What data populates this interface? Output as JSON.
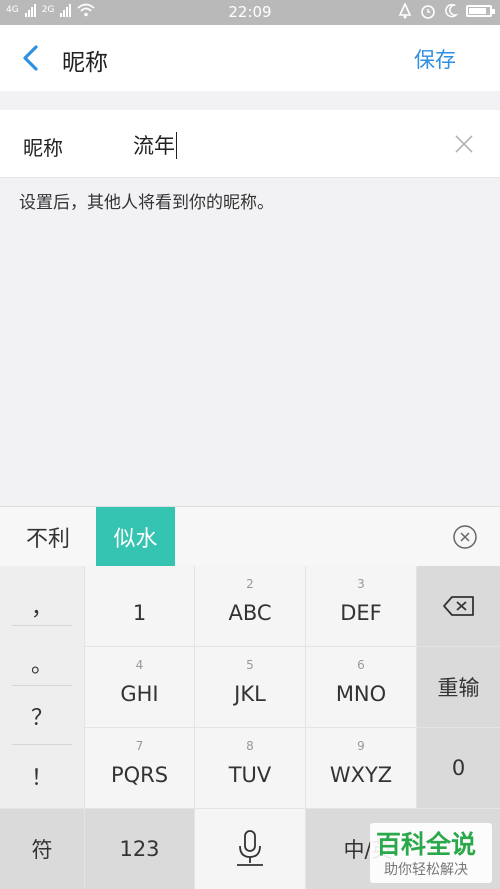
{
  "status_bar": {
    "net1": "4G",
    "net2": "2G",
    "time": "22:09",
    "battery": 0.85
  },
  "header": {
    "title": "昵称",
    "save_label": "保存"
  },
  "nickname_field": {
    "label": "昵称",
    "value": "流年"
  },
  "hint": "设置后，其他人将看到你的昵称。",
  "candidates": [
    "不利",
    "似水"
  ],
  "keyboard": {
    "punctuation": [
      "，",
      "。",
      "？",
      "！"
    ],
    "rows": [
      [
        {
          "num": "",
          "label": "1"
        },
        {
          "num": "2",
          "label": "ABC"
        },
        {
          "num": "3",
          "label": "DEF"
        }
      ],
      [
        {
          "num": "4",
          "label": "GHI"
        },
        {
          "num": "5",
          "label": "JKL"
        },
        {
          "num": "6",
          "label": "MNO"
        }
      ],
      [
        {
          "num": "7",
          "label": "PQRS"
        },
        {
          "num": "8",
          "label": "TUV"
        },
        {
          "num": "9",
          "label": "WXYZ"
        }
      ]
    ],
    "retype_label": "重输",
    "zero_label": "0",
    "symbol_label": "符",
    "num_mode_label": "123",
    "lang_label": "中/英"
  },
  "icons": {
    "back": "chevron-left-icon",
    "clear": "close-icon",
    "collapse": "circle-x-icon",
    "delete": "backspace-icon",
    "mic": "microphone-icon"
  },
  "colors": {
    "accent": "#2f8fe0",
    "candidate_highlight": "#35c3b2",
    "watermark": "#2aa84a"
  },
  "watermark": {
    "main": "百科全说",
    "sub": "助你轻松解决"
  }
}
